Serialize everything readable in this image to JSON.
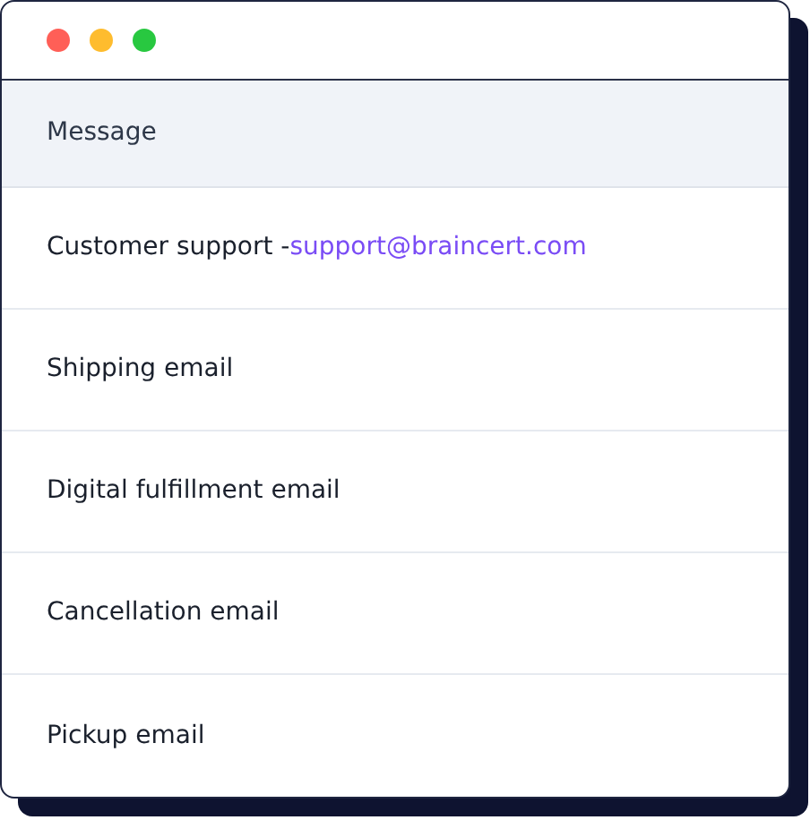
{
  "window": {
    "controls": [
      {
        "color": "#ff5f57"
      },
      {
        "color": "#febc2e"
      },
      {
        "color": "#28c840"
      }
    ]
  },
  "table": {
    "header": "Message",
    "rows": [
      {
        "text": "Customer support -",
        "email": "support@braincert.com"
      },
      {
        "text": "Shipping email"
      },
      {
        "text": "Digital fulfillment email"
      },
      {
        "text": "Cancellation email"
      },
      {
        "text": "Pickup email"
      }
    ]
  }
}
